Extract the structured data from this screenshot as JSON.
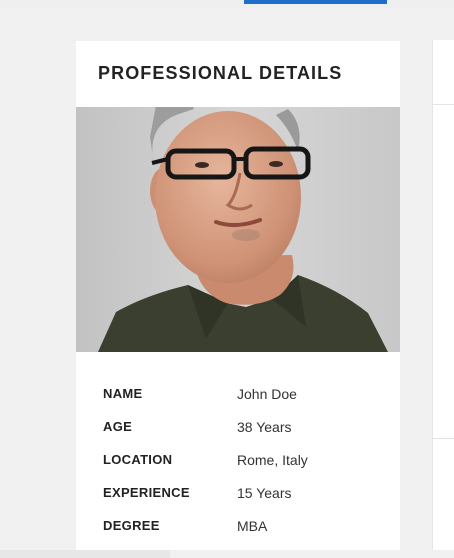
{
  "card": {
    "title": "PROFESSIONAL DETAILS",
    "photo_alt": "Profile photo of John Doe",
    "details": [
      {
        "label": "NAME",
        "value": "John Doe"
      },
      {
        "label": "AGE",
        "value": "38 Years"
      },
      {
        "label": "LOCATION",
        "value": "Rome, Italy"
      },
      {
        "label": "EXPERIENCE",
        "value": "15 Years"
      },
      {
        "label": "DEGREE",
        "value": "MBA"
      }
    ]
  },
  "colors": {
    "accent": "#1e6fc8",
    "page_background": "#f1f1f1",
    "card_background": "#ffffff",
    "text": "#222222",
    "shirt": "#3a3f2f"
  }
}
